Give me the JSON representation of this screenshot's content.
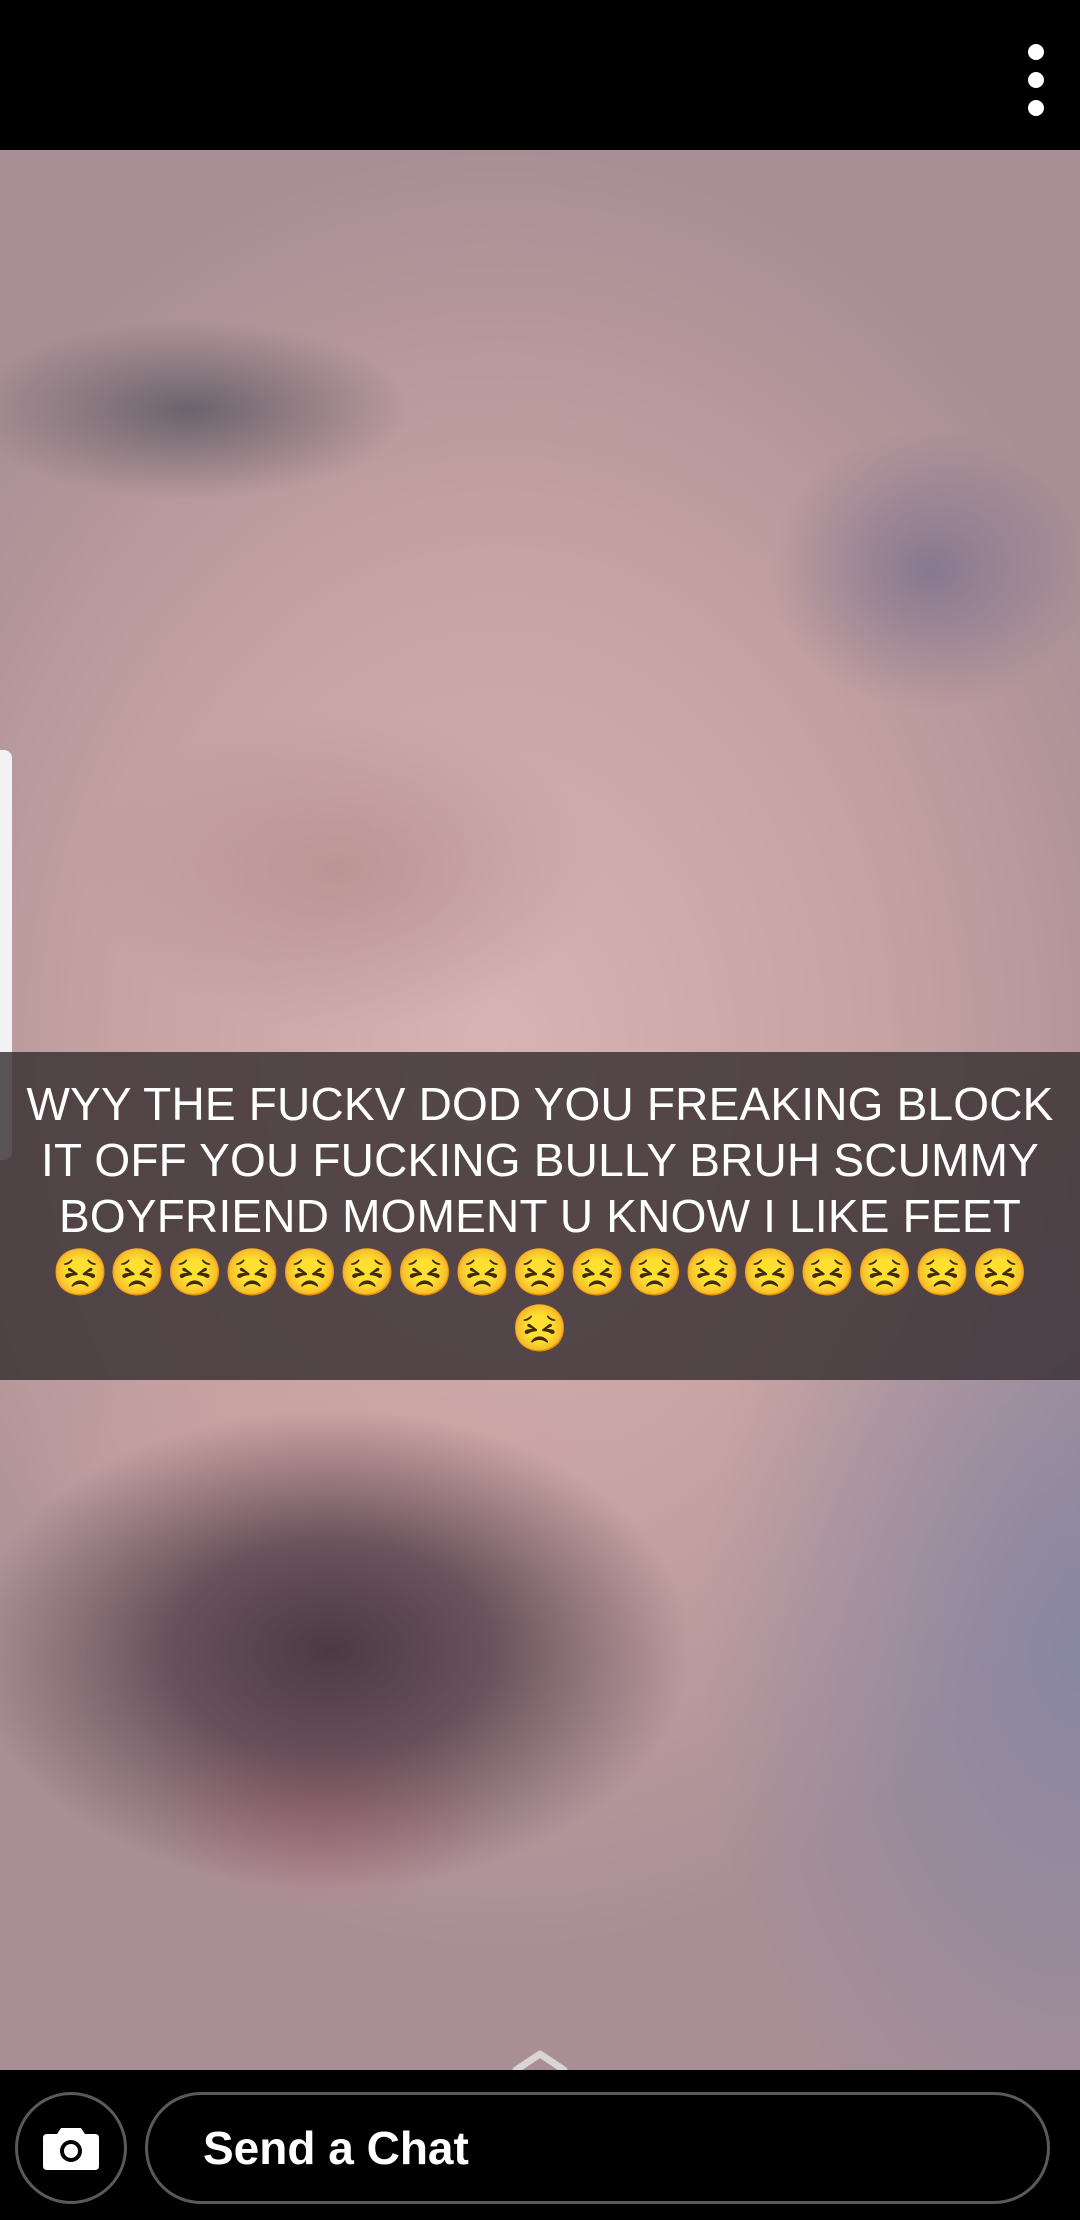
{
  "header": {
    "more_icon": "more-vertical-icon"
  },
  "snap": {
    "caption": "WYY THE FUCKV DOD YOU FREAKING BLOCK IT OFF YOU FUCKING BULLY BRUH SCUMMY BOYFRIEND MOMENT U KNOW I LIKE FEET 😣😣😣😣😣😣😣😣😣😣😣😣😣😣😣😣😣😣"
  },
  "footer": {
    "camera_icon": "camera-icon",
    "chat_placeholder": "Send a Chat",
    "swipe_icon": "chevron-up-icon"
  },
  "colors": {
    "background": "#000000",
    "caption_bar": "#383032",
    "text": "#ffffff",
    "input_border": "#5a5a5a"
  }
}
